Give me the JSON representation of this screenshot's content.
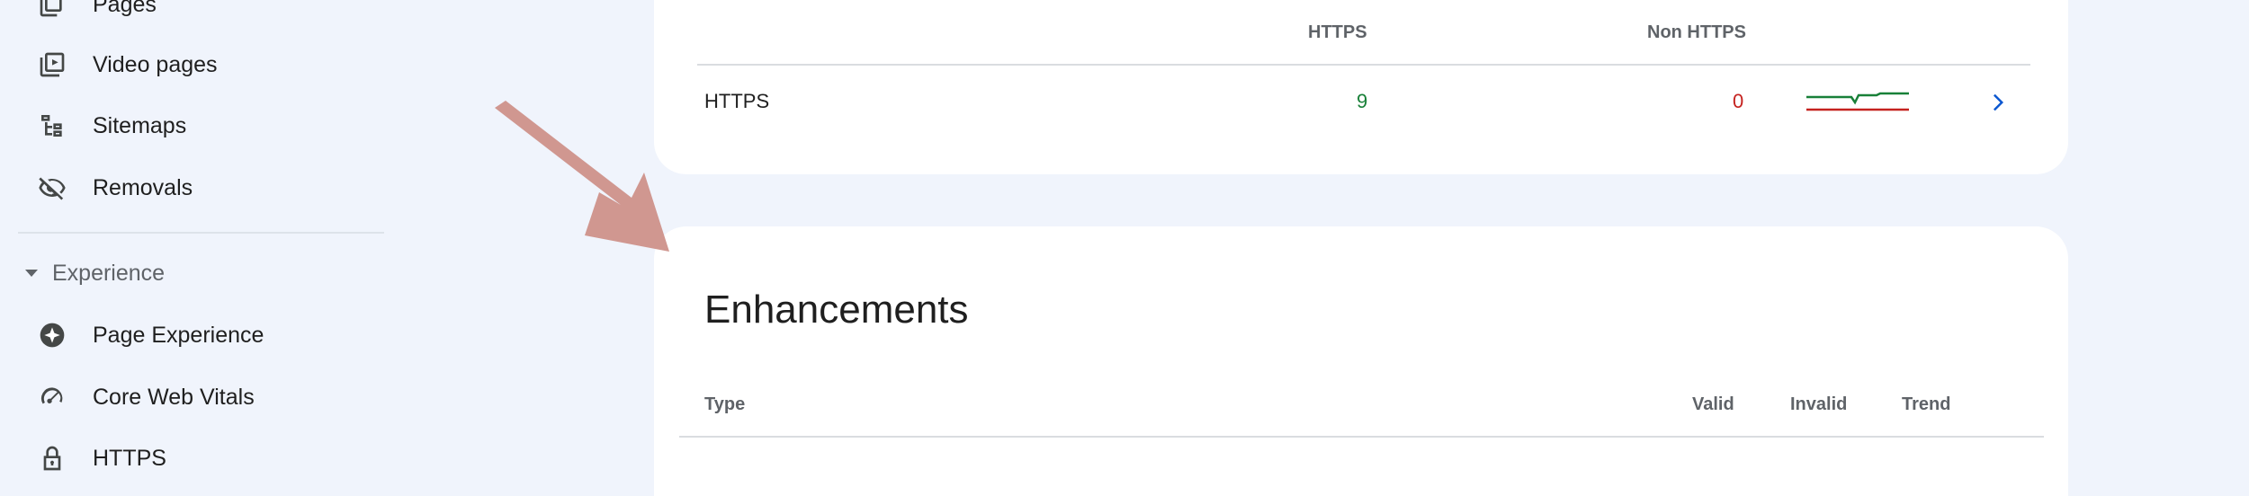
{
  "sidebar": {
    "items": [
      {
        "label": "Pages",
        "icon": "pages-icon"
      },
      {
        "label": "Video pages",
        "icon": "video-pages-icon"
      },
      {
        "label": "Sitemaps",
        "icon": "sitemap-icon"
      },
      {
        "label": "Removals",
        "icon": "eye-off-icon"
      }
    ],
    "section": {
      "label": "Experience",
      "icon": "caret-down-icon"
    },
    "experience_items": [
      {
        "label": "Page Experience",
        "icon": "page-experience-icon"
      },
      {
        "label": "Core Web Vitals",
        "icon": "gauge-icon"
      },
      {
        "label": "HTTPS",
        "icon": "lock-icon"
      }
    ]
  },
  "https_table": {
    "headers": {
      "https": "HTTPS",
      "non_https": "Non HTTPS"
    },
    "row": {
      "label": "HTTPS",
      "https_count": "9",
      "non_https_count": "0"
    }
  },
  "enhancements": {
    "title": "Enhancements",
    "headers": {
      "type": "Type",
      "valid": "Valid",
      "invalid": "Invalid",
      "trend": "Trend"
    }
  },
  "colors": {
    "valid_green": "#188038",
    "error_red": "#c5221f",
    "link_blue": "#0b57d0",
    "annotation_arrow": "#cd918a"
  }
}
